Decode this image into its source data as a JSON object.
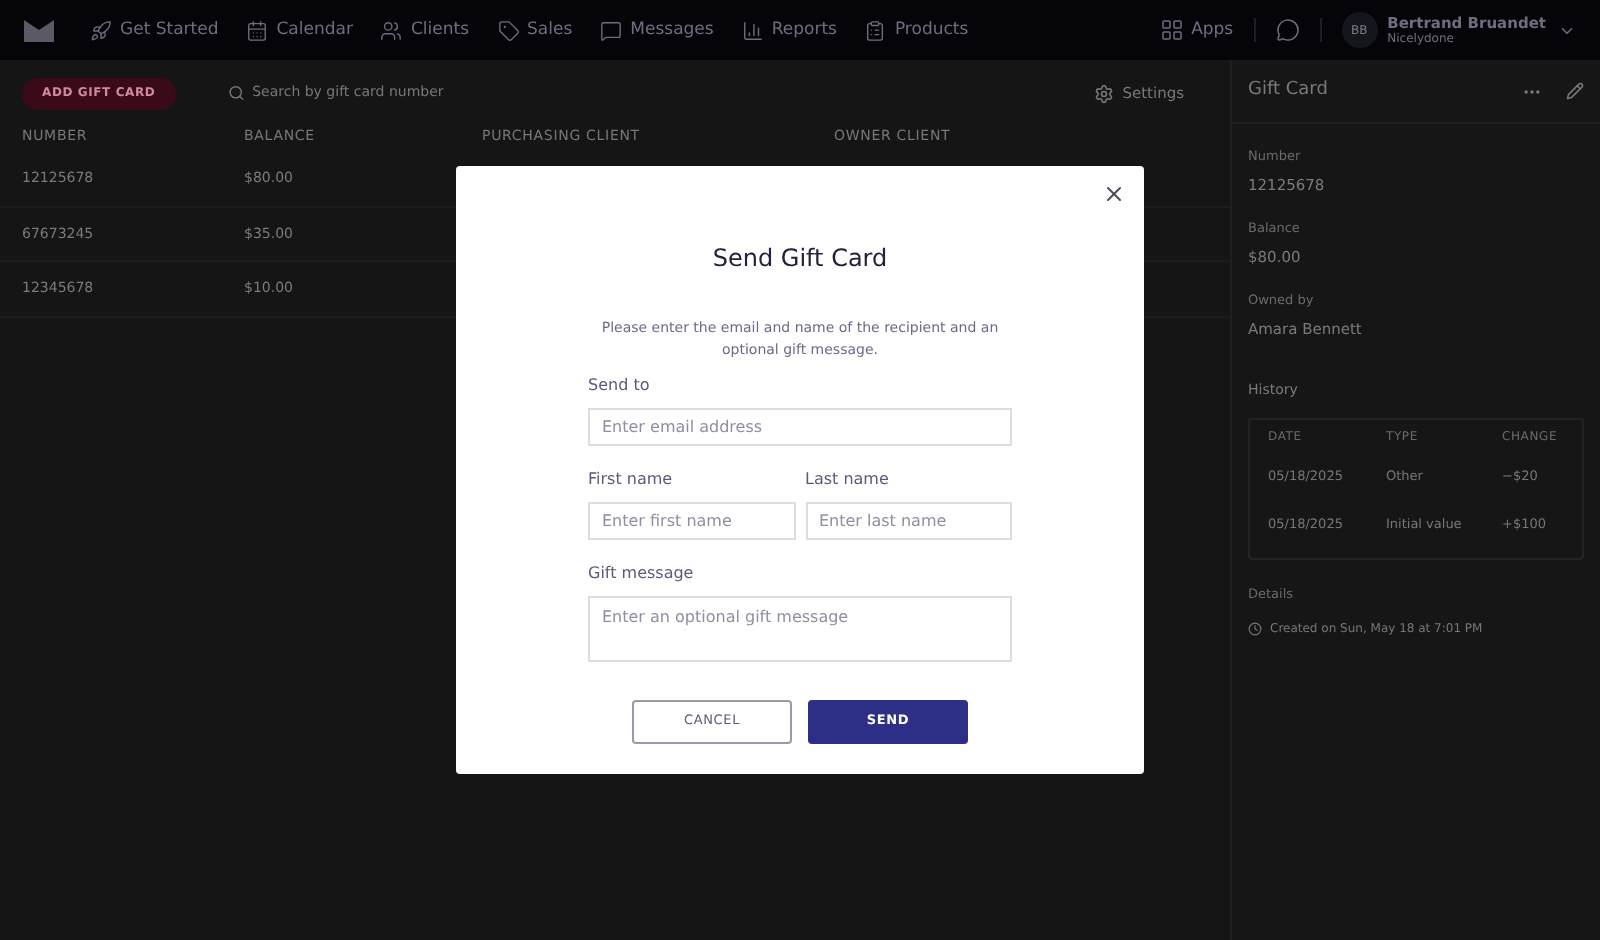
{
  "nav": {
    "items": [
      {
        "label": "Get Started",
        "kind": "rocket"
      },
      {
        "label": "Calendar",
        "kind": "calendar"
      },
      {
        "label": "Clients",
        "kind": "users"
      },
      {
        "label": "Sales",
        "kind": "tag"
      },
      {
        "label": "Messages",
        "kind": "chat"
      },
      {
        "label": "Reports",
        "kind": "chart"
      },
      {
        "label": "Products",
        "kind": "clipboard"
      }
    ],
    "apps": "Apps",
    "user": {
      "initials": "BB",
      "name": "Bertrand Bruandet",
      "business": "Nicelydone"
    }
  },
  "toolbar": {
    "add_button": "ADD GIFT CARD",
    "search_placeholder": "Search by gift card number",
    "settings": "Settings"
  },
  "table": {
    "columns": [
      "NUMBER",
      "BALANCE",
      "PURCHASING CLIENT",
      "OWNER CLIENT"
    ],
    "rows": [
      {
        "number": "12125678",
        "balance": "$80.00"
      },
      {
        "number": "67673245",
        "balance": "$35.00"
      },
      {
        "number": "12345678",
        "balance": "$10.00"
      }
    ]
  },
  "detail": {
    "title": "Gift Card",
    "fields": [
      {
        "label": "Number",
        "value": "12125678"
      },
      {
        "label": "Balance",
        "value": "$80.00"
      },
      {
        "label": "Owned by",
        "value": "Amara Bennett"
      }
    ],
    "history_title": "History",
    "history_columns": [
      "DATE",
      "TYPE",
      "CHANGE"
    ],
    "history_rows": [
      [
        "05/18/2025",
        "Other",
        "−$20"
      ],
      [
        "05/18/2025",
        "Initial value",
        "+$100"
      ]
    ],
    "details_title": "Details",
    "created": "Created on Sun, May 18 at 7:01 PM"
  },
  "dialog": {
    "title": "Send Gift Card",
    "description": "Please enter the email and name of the recipient and an optional gift message.",
    "send_to": {
      "label": "Send to",
      "placeholder": "Enter email address"
    },
    "first_name": {
      "label": "First name",
      "placeholder": "Enter first name"
    },
    "last_name": {
      "label": "Last name",
      "placeholder": "Enter last name"
    },
    "message": {
      "label": "Gift message",
      "placeholder": "Enter an optional gift message"
    },
    "cancel": "CANCEL",
    "send": "SEND"
  }
}
